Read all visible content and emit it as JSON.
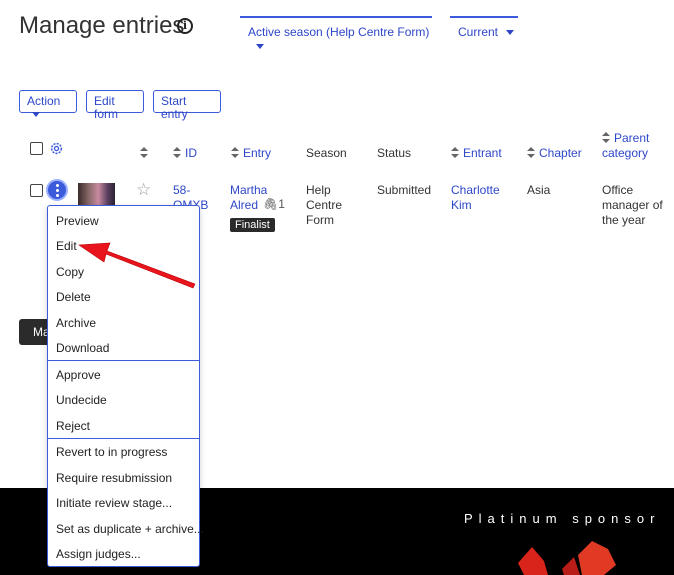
{
  "page": {
    "title": "Manage entries"
  },
  "filters": {
    "season": "Active season (Help Centre Form)",
    "view": "Current"
  },
  "toolbar": {
    "action": "Action",
    "edit_form": "Edit form",
    "start_entry": "Start entry"
  },
  "table": {
    "headers": {
      "id": "ID",
      "entry": "Entry",
      "season": "Season",
      "status": "Status",
      "entrant": "Entrant",
      "chapter": "Chapter",
      "parent_category_1": "Parent",
      "parent_category_2": "category"
    },
    "row": {
      "id_1": "58-",
      "id_2": "QMXB",
      "entry_1": "Martha",
      "entry_2": "Alred",
      "attachments": "1",
      "badge": "Finalist",
      "season_1": "Help",
      "season_2": "Centre",
      "season_3": "Form",
      "status": "Submitted",
      "entrant_1": "Charlotte",
      "entrant_2": "Kim",
      "chapter": "Asia",
      "parent_1": "Office",
      "parent_2": "manager of",
      "parent_3": "the year"
    }
  },
  "dark_button": {
    "label": "Ma"
  },
  "menu": {
    "group1": [
      "Preview",
      "Edit",
      "Copy",
      "Delete",
      "Archive",
      "Download"
    ],
    "group2": [
      "Approve",
      "Undecide",
      "Reject"
    ],
    "group3": [
      "Revert to in progress",
      "Require resubmission",
      "Initiate review stage...",
      "Set as duplicate + archive...",
      "Assign judges..."
    ]
  },
  "footer": {
    "sponsor_text": "Platinum sponsor"
  },
  "colors": {
    "accent": "#3b5bdb",
    "link": "#2d47c8",
    "arrow": "#e8141e",
    "footer_bg": "#000000"
  }
}
